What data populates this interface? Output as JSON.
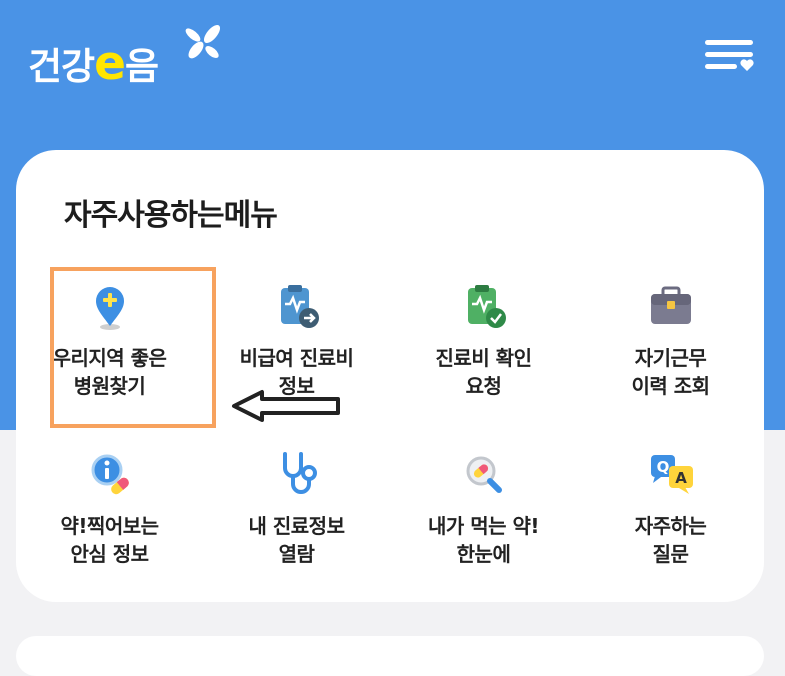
{
  "header": {
    "logo": {
      "text_before": "건강",
      "text_e": "e",
      "text_after": "음"
    },
    "menu_icon": "hamburger-heart-icon"
  },
  "frequent_menu": {
    "title": "자주사용하는메뉴",
    "items": [
      {
        "label": "우리지역 좋은\n병원찾기",
        "icon": "map-pin-icon"
      },
      {
        "label": "비급여 진료비\n정보",
        "icon": "clipboard-arrow-icon"
      },
      {
        "label": "진료비 확인\n요청",
        "icon": "clipboard-check-icon"
      },
      {
        "label": "자기근무\n이력 조회",
        "icon": "briefcase-icon"
      },
      {
        "label": "약!찍어보는\n안심 정보",
        "icon": "info-pill-icon"
      },
      {
        "label": "내 진료정보\n열람",
        "icon": "stethoscope-icon"
      },
      {
        "label": "내가 먹는 약!\n한눈에",
        "icon": "magnifier-pill-icon"
      },
      {
        "label": "자주하는\n질문",
        "icon": "qa-bubbles-icon"
      }
    ]
  },
  "annotation": {
    "highlight_color": "#f7a25e",
    "arrow_color": "#222222"
  },
  "colors": {
    "header": "#4a93e6",
    "logo_e": "#ffe500"
  }
}
